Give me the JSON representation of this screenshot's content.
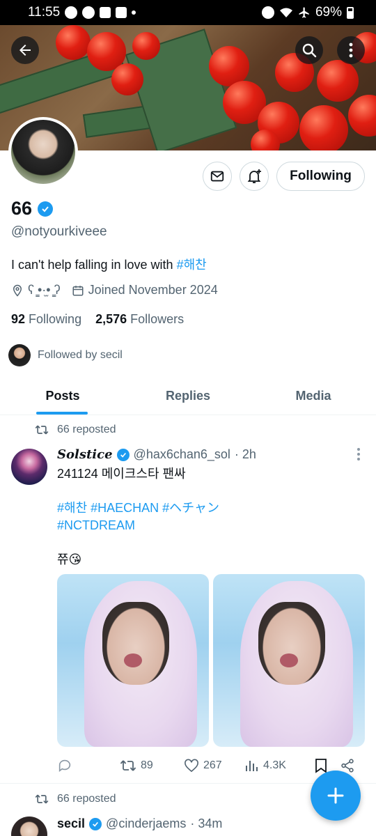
{
  "status_bar": {
    "time": "11:55",
    "battery": "69%"
  },
  "profile": {
    "display_name": "66",
    "handle": "@notyourkiveee",
    "bio_prefix": "I can't help falling in love with ",
    "bio_hashtag": "#해찬",
    "location": "ʕ ̳•·̫• ̳ʔ",
    "joined": "Joined November 2024",
    "following_count": "92",
    "following_label": "Following",
    "followers_count": "2,576",
    "followers_label": "Followers",
    "followed_by": "Followed by secil",
    "follow_button": "Following"
  },
  "tabs": [
    {
      "label": "Posts",
      "active": true
    },
    {
      "label": "Replies",
      "active": false
    },
    {
      "label": "Media",
      "active": false
    }
  ],
  "posts": [
    {
      "repost_label": "66 reposted",
      "author": "Solstice",
      "handle": "@hax6chan6_sol",
      "time": "· 2h",
      "text_line1": "241124 메이크스타 팬싸",
      "hashtags_line1": "#해찬 #HAECHAN #ヘチャン",
      "hashtags_line2": "#NCTDREAM",
      "text_line3": "쮸😘",
      "replies": "",
      "reposts": "89",
      "likes": "267",
      "views": "4.3K"
    },
    {
      "repost_label": "66 reposted",
      "author": "secil",
      "handle": "@cinderjaems",
      "time": "· 34m"
    }
  ],
  "colors": {
    "accent": "#1d9bf0",
    "muted": "#536471",
    "text": "#0f1419"
  },
  "icons": [
    "back-arrow-icon",
    "search-icon",
    "more-vertical-icon",
    "message-icon",
    "bell-plus-icon",
    "verified-badge-icon",
    "location-icon",
    "calendar-icon",
    "repost-icon",
    "reply-icon",
    "like-icon",
    "views-icon",
    "bookmark-icon",
    "share-icon",
    "plus-icon"
  ]
}
